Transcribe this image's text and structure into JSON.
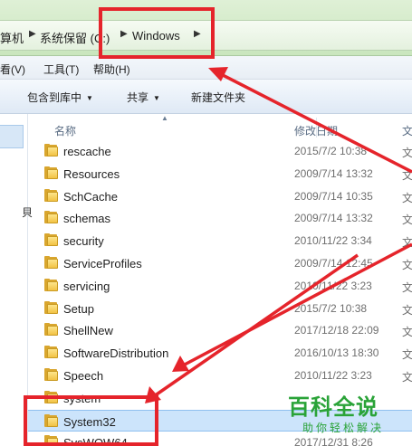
{
  "address": {
    "crumbs": [
      "算机",
      "系统保留 (C:)",
      "Windows"
    ]
  },
  "menu": {
    "items": [
      "看(V)",
      "工具(T)",
      "帮助(H)"
    ]
  },
  "toolbar": {
    "include_label": "包含到库中",
    "share_label": "共享",
    "new_folder_label": "新建文件夹"
  },
  "navpane": {
    "glyph": "貝"
  },
  "columns": {
    "name": "名称",
    "date": "修改日期",
    "type": "文"
  },
  "files": [
    {
      "name": "rescache",
      "date": "2015/7/2 10:38",
      "type": "文"
    },
    {
      "name": "Resources",
      "date": "2009/7/14 13:32",
      "type": "文"
    },
    {
      "name": "SchCache",
      "date": "2009/7/14 10:35",
      "type": "文"
    },
    {
      "name": "schemas",
      "date": "2009/7/14 13:32",
      "type": "文"
    },
    {
      "name": "security",
      "date": "2010/11/22 3:34",
      "type": "文"
    },
    {
      "name": "ServiceProfiles",
      "date": "2009/7/14 12:45",
      "type": "文"
    },
    {
      "name": "servicing",
      "date": "2010/11/22 3:23",
      "type": "文"
    },
    {
      "name": "Setup",
      "date": "2015/7/2 10:38",
      "type": "文"
    },
    {
      "name": "ShellNew",
      "date": "2017/12/18 22:09",
      "type": "文"
    },
    {
      "name": "SoftwareDistribution",
      "date": "2016/10/13 18:30",
      "type": "文"
    },
    {
      "name": "Speech",
      "date": "2010/11/22 3:23",
      "type": "文"
    },
    {
      "name": "system",
      "date": "",
      "type": ""
    },
    {
      "name": "System32",
      "date": "",
      "type": ""
    },
    {
      "name": "SysWOW64",
      "date": "2017/12/31 8:26",
      "type": ""
    }
  ],
  "watermark": {
    "title": "百科全说",
    "subtitle": "助你轻松解决"
  },
  "colors": {
    "annotation_red": "#e5242b",
    "watermark_green": "#2aa338",
    "selection_blue": "#cce4fb",
    "folder_yellow": "#f2c244"
  },
  "icons": {
    "folder": "folder-icon",
    "breadcrumb_separator": "triangle-right-icon",
    "dropdown": "triangle-down-icon"
  }
}
